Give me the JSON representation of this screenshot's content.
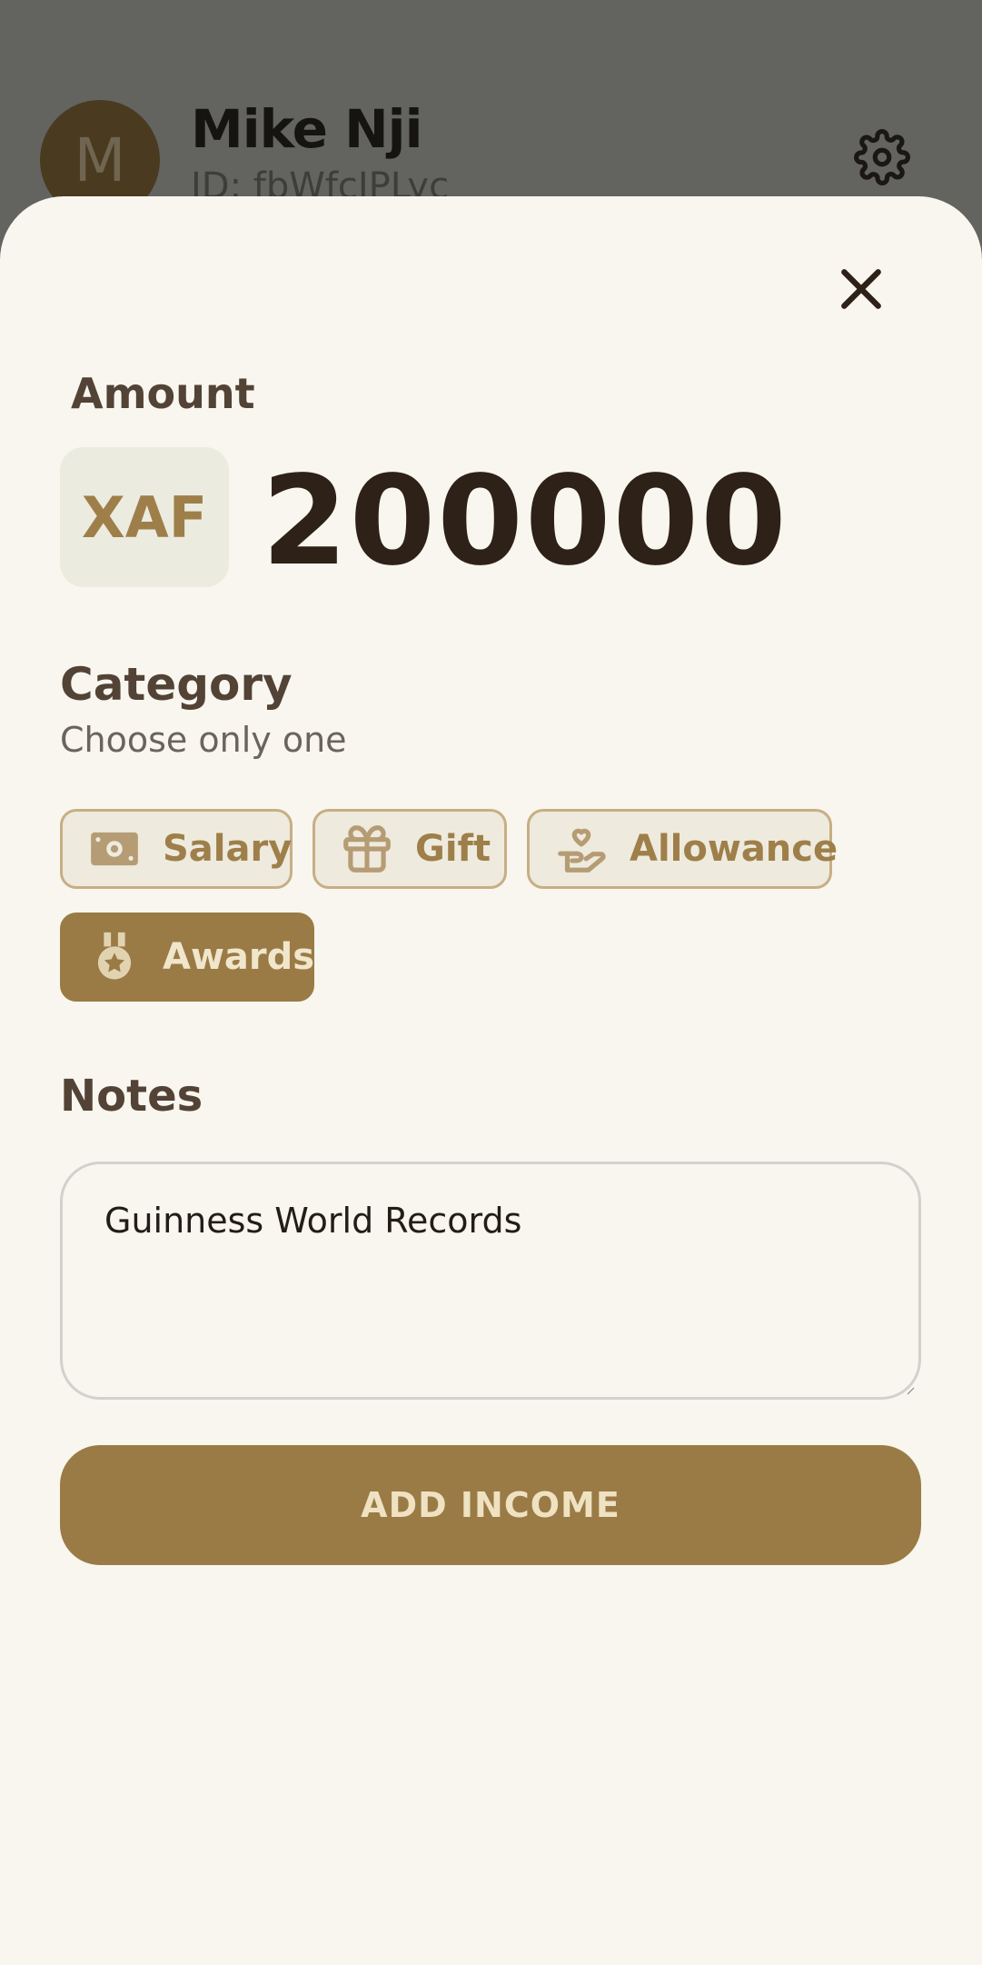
{
  "profile": {
    "avatar_initial": "M",
    "name": "Mike Nji",
    "id_text": "ID: fbWfcIPLyc"
  },
  "icons": {
    "settings": "gear-icon",
    "close": "close-icon",
    "salary": "banknote-icon",
    "gift": "gift-icon",
    "allowance": "hand-heart-icon",
    "awards": "medal-icon"
  },
  "amount": {
    "label": "Amount",
    "currency": "XAF",
    "value": "200000"
  },
  "category": {
    "label": "Category",
    "hint": "Choose only one",
    "options": [
      {
        "label": "Salary",
        "selected": false
      },
      {
        "label": "Gift",
        "selected": false
      },
      {
        "label": "Allowance",
        "selected": false
      },
      {
        "label": "Awards",
        "selected": true
      }
    ]
  },
  "notes": {
    "label": "Notes",
    "value": "Guinness World Records"
  },
  "submit_label": "ADD INCOME",
  "colors": {
    "accent": "#9a7b45",
    "sheet_bg": "#f8f6ee",
    "overlay": "#636360",
    "chip_border": "#c8ae85",
    "heading": "#524336"
  }
}
